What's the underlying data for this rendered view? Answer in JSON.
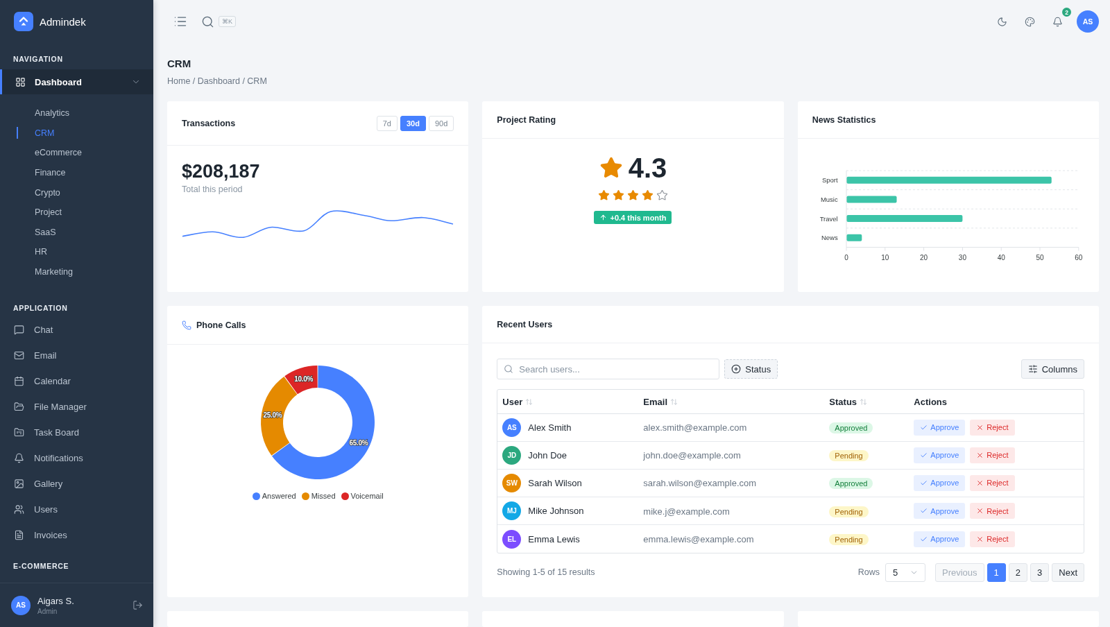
{
  "sidebar": {
    "brand": "Admindek",
    "sections": [
      {
        "title": "NAVIGATION",
        "items": [
          {
            "label": "Dashboard",
            "selected": true,
            "expanded": true,
            "children": [
              {
                "label": "Analytics",
                "selected": false
              },
              {
                "label": "CRM",
                "selected": true
              },
              {
                "label": "eCommerce",
                "selected": false
              },
              {
                "label": "Finance",
                "selected": false
              },
              {
                "label": "Crypto",
                "selected": false
              },
              {
                "label": "Project",
                "selected": false
              },
              {
                "label": "SaaS",
                "selected": false
              },
              {
                "label": "HR",
                "selected": false
              },
              {
                "label": "Marketing",
                "selected": false
              }
            ]
          }
        ]
      },
      {
        "title": "APPLICATION",
        "items": [
          {
            "label": "Chat",
            "selected": false
          },
          {
            "label": "Email",
            "selected": false
          },
          {
            "label": "Calendar",
            "selected": false
          },
          {
            "label": "File Manager",
            "selected": false
          },
          {
            "label": "Task Board",
            "selected": false
          },
          {
            "label": "Notifications",
            "selected": false
          },
          {
            "label": "Gallery",
            "selected": false
          },
          {
            "label": "Users",
            "selected": false
          },
          {
            "label": "Invoices",
            "selected": false
          }
        ]
      },
      {
        "title": "E-COMMERCE"
      }
    ],
    "user": {
      "initials": "AS",
      "name": "Aigars S.",
      "role": "Admin"
    }
  },
  "topbar": {
    "shortcut": "⌘K",
    "notification_count": "2",
    "avatar_initials": "AS"
  },
  "page": {
    "title": "CRM",
    "breadcrumb": "Home / Dashboard / CRM"
  },
  "transactions": {
    "title": "Transactions",
    "ranges": [
      {
        "label": "7d",
        "selected": false
      },
      {
        "label": "30d",
        "selected": true
      },
      {
        "label": "90d",
        "selected": false
      }
    ],
    "amount": "$208,187",
    "caption": "Total this period"
  },
  "project_rating": {
    "title": "Project Rating",
    "value": "4.3",
    "stars": 4,
    "change": "+0.4 this month"
  },
  "news_statistics": {
    "title": "News Statistics",
    "chart_data": {
      "type": "bar",
      "orientation": "horizontal",
      "categories": [
        "Sport",
        "Music",
        "Travel",
        "News"
      ],
      "series": [
        {
          "color": "#3cc4a8",
          "values": [
            53,
            13,
            30,
            4
          ]
        }
      ],
      "xlim": [
        0,
        60
      ],
      "xticks": [
        0,
        10,
        20,
        30,
        40,
        50,
        60
      ]
    }
  },
  "phone_calls": {
    "title": "Phone Calls",
    "chart_data": {
      "type": "donut",
      "categories": [
        "Answered",
        "Missed",
        "Voicemail"
      ],
      "series": [
        {
          "values": [
            65,
            25,
            10
          ]
        }
      ],
      "colors": [
        "#4680ff",
        "#e58a00",
        "#dc2626"
      ],
      "value_labels": [
        "65.0%",
        "25.0%",
        "10.0%"
      ]
    }
  },
  "recent_users": {
    "title": "Recent Users",
    "search": {
      "placeholder": "Search users..."
    },
    "status_filter": "Status",
    "columns_button": "Columns",
    "table": {
      "columns": [
        {
          "label": "User",
          "sortable": true
        },
        {
          "label": "Email",
          "sortable": true
        },
        {
          "label": "Status",
          "sortable": true
        },
        {
          "label": "Actions",
          "sortable": false
        }
      ],
      "rows": [
        {
          "initials": "AS",
          "color": "#4680ff",
          "name": "Alex Smith",
          "email": "alex.smith@example.com",
          "status": {
            "label": "Approved",
            "kind": "approved"
          },
          "actions": [
            {
              "label": "Approve",
              "kind": "approve"
            },
            {
              "label": "Reject",
              "kind": "reject"
            }
          ]
        },
        {
          "initials": "JD",
          "color": "#2ca87f",
          "name": "John Doe",
          "email": "john.doe@example.com",
          "status": {
            "label": "Pending",
            "kind": "pending"
          },
          "actions": [
            {
              "label": "Approve",
              "kind": "approve"
            },
            {
              "label": "Reject",
              "kind": "reject"
            }
          ]
        },
        {
          "initials": "SW",
          "color": "#e58a00",
          "name": "Sarah Wilson",
          "email": "sarah.wilson@example.com",
          "status": {
            "label": "Approved",
            "kind": "approved"
          },
          "actions": [
            {
              "label": "Approve",
              "kind": "approve"
            },
            {
              "label": "Reject",
              "kind": "reject"
            }
          ]
        },
        {
          "initials": "MJ",
          "color": "#13a8e6",
          "name": "Mike Johnson",
          "email": "mike.j@example.com",
          "status": {
            "label": "Pending",
            "kind": "pending"
          },
          "actions": [
            {
              "label": "Approve",
              "kind": "approve"
            },
            {
              "label": "Reject",
              "kind": "reject"
            }
          ]
        },
        {
          "initials": "EL",
          "color": "#7c4dff",
          "name": "Emma Lewis",
          "email": "emma.lewis@example.com",
          "status": {
            "label": "Pending",
            "kind": "pending"
          },
          "actions": [
            {
              "label": "Approve",
              "kind": "approve"
            },
            {
              "label": "Reject",
              "kind": "reject"
            }
          ]
        }
      ]
    },
    "summary": "Showing 1-5 of 15 results",
    "rows_label": "Rows",
    "rows_value": "5",
    "pagination": {
      "previous": {
        "label": "Previous",
        "disabled": true
      },
      "pages": [
        {
          "label": "1",
          "selected": true
        },
        {
          "label": "2",
          "selected": false
        },
        {
          "label": "3",
          "selected": false
        }
      ],
      "next": {
        "label": "Next",
        "disabled": false
      }
    }
  }
}
